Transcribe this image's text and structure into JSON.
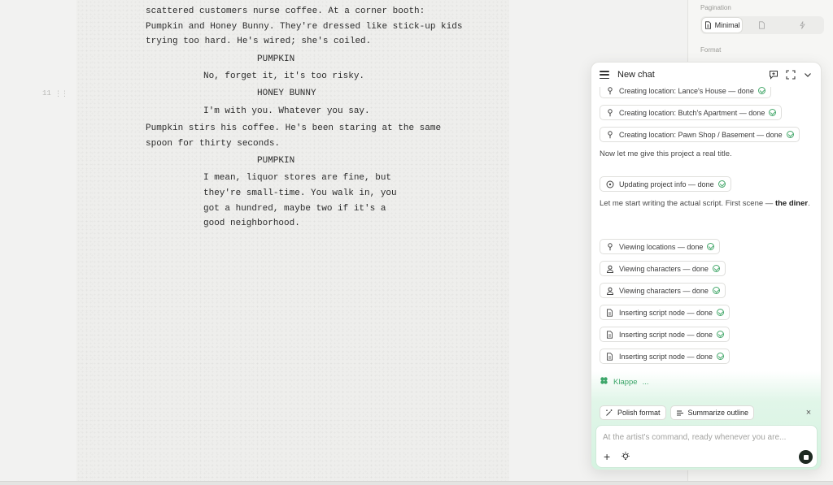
{
  "script": {
    "scene_number": "11",
    "lines": [
      {
        "kind": "action",
        "text": "scattered customers nurse coffee. At a corner booth:"
      },
      {
        "kind": "action",
        "text": "Pumpkin and Honey Bunny. They're dressed like stick-up kids"
      },
      {
        "kind": "action",
        "text": "trying too hard. He's wired; she's coiled."
      },
      {
        "kind": "character",
        "text": "PUMPKIN"
      },
      {
        "kind": "dialogue",
        "text": "No, forget it, it's too risky."
      },
      {
        "kind": "character",
        "text": "HONEY BUNNY"
      },
      {
        "kind": "dialogue",
        "text": "I'm with you. Whatever you say."
      },
      {
        "kind": "action",
        "text": "Pumpkin stirs his coffee. He's been staring at the same"
      },
      {
        "kind": "action",
        "text": "spoon for thirty seconds."
      },
      {
        "kind": "character",
        "text": "PUMPKIN"
      },
      {
        "kind": "dialogue",
        "text": "I mean, liquor stores are fine, but"
      },
      {
        "kind": "dialogue",
        "text": "they're small-time. You walk in, you"
      },
      {
        "kind": "dialogue",
        "text": "got a hundred, maybe two if it's a"
      },
      {
        "kind": "dialogue",
        "text": "good neighborhood."
      }
    ]
  },
  "settings": {
    "pagination_label": "Pagination",
    "pagination_options": [
      "Minimal",
      "",
      ""
    ],
    "format_label": "Format"
  },
  "chat": {
    "title": "New chat",
    "tool_calls": [
      {
        "icon": "pin-icon",
        "label": "Creating location: Lance's House — done"
      },
      {
        "icon": "pin-icon",
        "label": "Creating location: Butch's Apartment — done"
      },
      {
        "icon": "pin-icon",
        "label": "Creating location: Pawn Shop / Basement — done"
      },
      {
        "icon": "info-icon",
        "label": "Updating project info — done"
      },
      {
        "icon": "pin-icon",
        "label": "Viewing locations — done"
      },
      {
        "icon": "person-icon",
        "label": "Viewing characters — done"
      },
      {
        "icon": "person-icon",
        "label": "Viewing characters — done"
      },
      {
        "icon": "doc-icon",
        "label": "Inserting script node — done"
      },
      {
        "icon": "doc-icon",
        "label": "Inserting script node — done"
      },
      {
        "icon": "doc-icon",
        "label": "Inserting script node — done"
      }
    ],
    "messages": [
      {
        "text": "Now let me give this project a real title."
      },
      {
        "text_before": "Let me start writing the actual script. First scene — ",
        "bold": "the diner",
        "text_after": "."
      }
    ],
    "assistant_name": "Klappe",
    "assistant_status": "...",
    "quick_actions": [
      "Polish format",
      "Summarize outline"
    ],
    "composer_placeholder": "At the artist's command, ready whenever you are...",
    "accent_color": "#3da66a"
  }
}
